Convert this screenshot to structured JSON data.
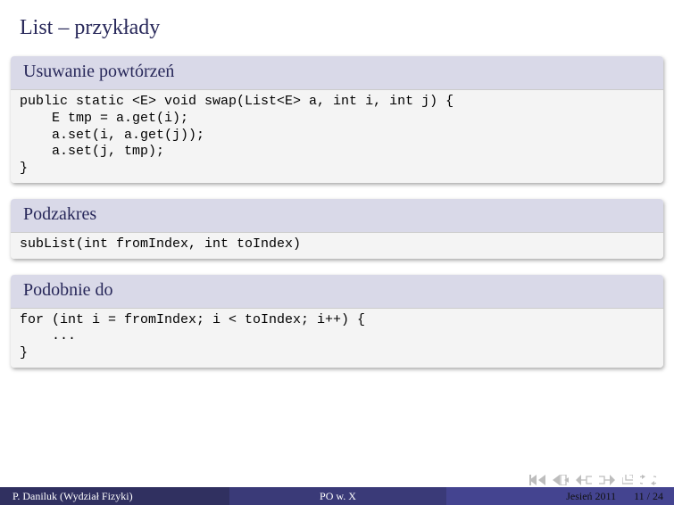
{
  "title": "List – przykłady",
  "blocks": [
    {
      "header": "Usuwanie powtórzeń",
      "code": "public static <E> void swap(List<E> a, int i, int j) {\n    E tmp = a.get(i);\n    a.set(i, a.get(j));\n    a.set(j, tmp);\n}"
    },
    {
      "header": "Podzakres",
      "code": "subList(int fromIndex, int toIndex)"
    },
    {
      "header": "Podobnie do",
      "code": "for (int i = fromIndex; i < toIndex; i++) {\n    ...\n}"
    }
  ],
  "footer": {
    "author": "P. Daniluk (Wydział Fizyki)",
    "title": "PO w. X",
    "date": "Jesień 2011",
    "page": "11 / 24"
  },
  "nav_icons": {
    "first": "first-slide-icon",
    "prev": "prev-slide-icon",
    "next": "next-slide-icon",
    "last": "last-slide-icon",
    "end": "end-icon",
    "cycle": "cycle-icon"
  }
}
